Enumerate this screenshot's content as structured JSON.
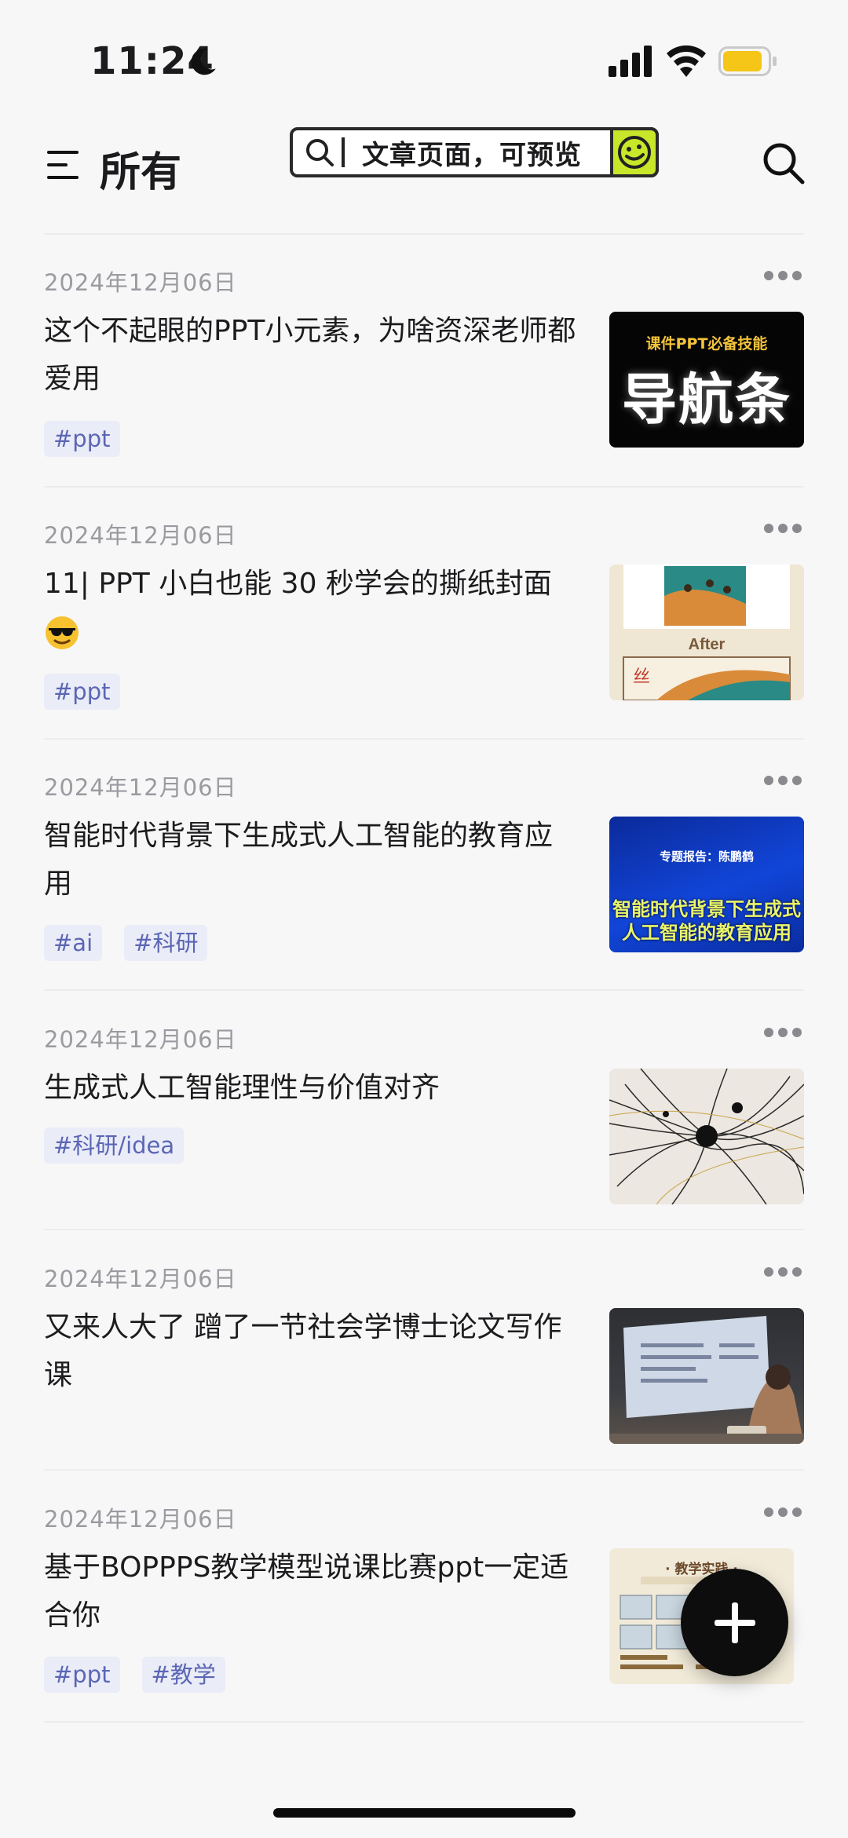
{
  "status_bar": {
    "time": "11:24"
  },
  "header": {
    "title": "所有",
    "preview_text": "文章页面，可预览"
  },
  "articles": [
    {
      "date": "2024年12月06日",
      "title": "这个不起眼的PPT小元素，为啥资深老师都爱用",
      "tags": [
        "#ppt"
      ],
      "thumb": {
        "subtitle": "课件PPT必备技能",
        "main": "导航条"
      }
    },
    {
      "date": "2024年12月06日",
      "title": "11| PPT 小白也能 30 秒学会的撕纸封面",
      "tags": [
        "#ppt"
      ],
      "thumb": {
        "label": "After"
      }
    },
    {
      "date": "2024年12月06日",
      "title": "智能时代背景下生成式人工智能的教育应用",
      "tags": [
        "#ai",
        "#科研"
      ],
      "thumb": {
        "small": "专题报告：陈鹏鹤",
        "line1": "智能时代背景下生成式",
        "line2": "人工智能的教育应用"
      }
    },
    {
      "date": "2024年12月06日",
      "title": "生成式人工智能理性与价值对齐",
      "tags": [
        "#科研/idea"
      ]
    },
    {
      "date": "2024年12月06日",
      "title": "又来人大了 蹭了一节社会学博士论文写作课",
      "tags": []
    },
    {
      "date": "2024年12月06日",
      "title": "基于BOPPPS教学模型说课比赛ppt一定适合你",
      "tags": [
        "#ppt",
        "#教学"
      ],
      "thumb": {
        "header": "· 教学实践 ·"
      }
    }
  ],
  "colors": {
    "background": "#f7f7f8",
    "tag_bg": "#eaecf7",
    "tag_text": "#5b66b5",
    "preview_accent": "#c8e62a",
    "battery": "#f5c518"
  },
  "icons": [
    "moon-icon",
    "signal-icon",
    "wifi-icon",
    "battery-icon",
    "menu-icon",
    "search-icon",
    "smile-icon",
    "more-icon",
    "sunglasses-emoji",
    "plus-icon"
  ]
}
